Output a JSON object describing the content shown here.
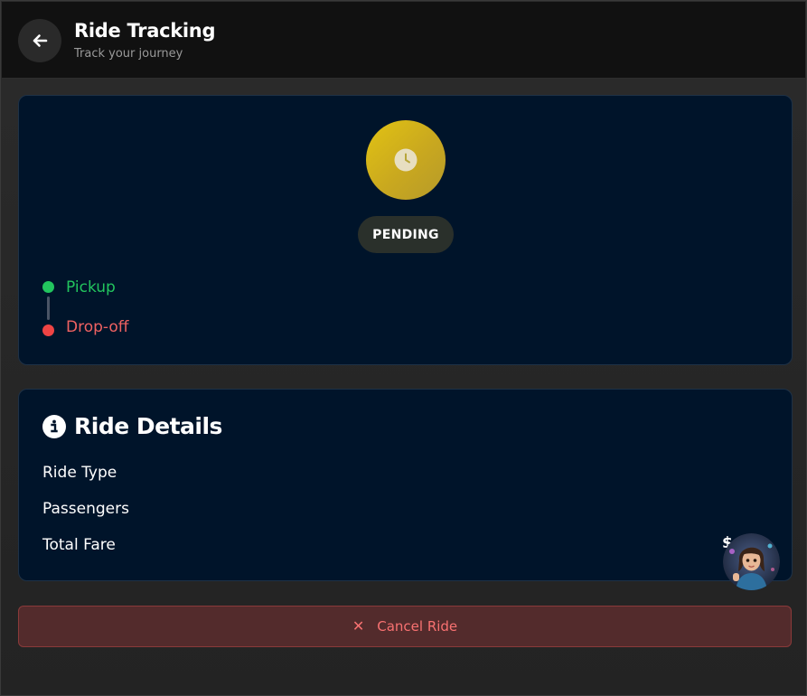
{
  "header": {
    "title": "Ride Tracking",
    "subtitle": "Track your journey",
    "back_icon": "arrow-left-icon"
  },
  "status": {
    "icon": "clock-icon",
    "label": "PENDING",
    "color": "#d4b81a"
  },
  "route": {
    "pickup_label": "Pickup",
    "dropoff_label": "Drop-off",
    "pickup_color": "#22c55e",
    "dropoff_color": "#ef4444"
  },
  "details": {
    "icon": "info-icon",
    "title": "Ride Details",
    "rows": [
      {
        "label": "Ride Type"
      },
      {
        "label": "Passengers"
      },
      {
        "label": "Total Fare",
        "value": "$"
      }
    ]
  },
  "actions": {
    "cancel_icon": "close-icon",
    "cancel_label": "Cancel Ride",
    "cancel_color": "#f87171"
  },
  "assistant": {
    "avatar_icon": "assistant-avatar"
  }
}
